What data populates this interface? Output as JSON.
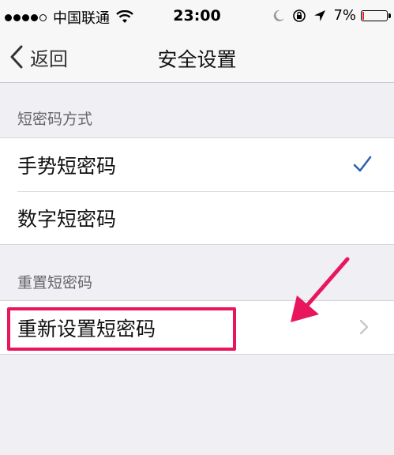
{
  "status_bar": {
    "carrier": "中国联通",
    "time": "23:00",
    "battery_percent": "7%",
    "battery_level": 0.07,
    "battery_color": "#e3242b"
  },
  "nav": {
    "back_label": "返回",
    "title": "安全设置"
  },
  "sections": [
    {
      "header": "短密码方式",
      "items": [
        {
          "label": "手势短密码",
          "checked": true
        },
        {
          "label": "数字短密码",
          "checked": false
        }
      ]
    },
    {
      "header": "重置短密码",
      "items": [
        {
          "label": "重新设置短密码",
          "accessory": "chevron-right-icon"
        }
      ]
    }
  ],
  "colors": {
    "accent": "#2f63b4",
    "annotation": "#e8175d",
    "background": "#efeff4"
  },
  "icons": [
    "wifi-icon",
    "moon-icon",
    "rotation-lock-icon",
    "location-arrow-icon",
    "battery-icon",
    "chevron-left-icon",
    "checkmark-icon",
    "chevron-right-icon"
  ]
}
